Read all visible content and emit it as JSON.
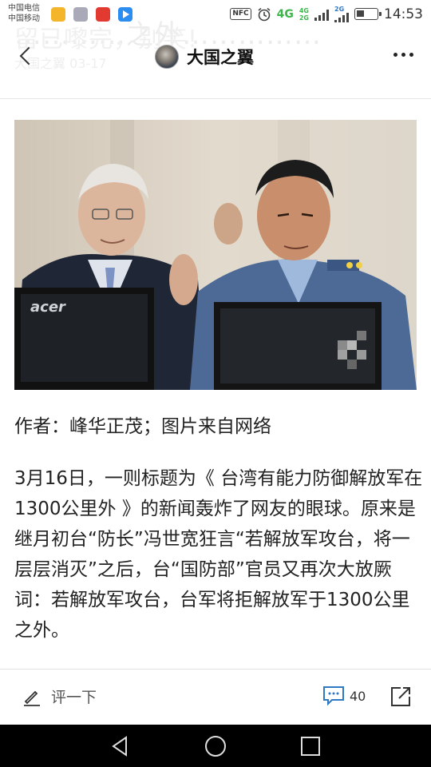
{
  "status_bar": {
    "carrier_1": "中国电信",
    "carrier_2": "中国移动",
    "nfc": "NFC",
    "network_4g": "4G",
    "network_small": "4G",
    "network_small_2": "2G",
    "network_2g_label": "2G",
    "time": "14:53"
  },
  "header": {
    "ghost_title": "…………之外……………",
    "ghost_title_line2": "留已嚟完，别笑!",
    "ghost_subtitle": "大国之翼  03-17",
    "title": "大国之翼",
    "back_icon": "chevron-left-icon",
    "more_icon": "more-dots-icon"
  },
  "article": {
    "author": "作者：峰华正茂；图片来自网络",
    "paragraph": "3月16日，一则标题为《 台湾有能力防御解放军在1300公里外 》的新闻轰炸了网友的眼球。原来是继月初台“防长”冯世宽狂言“若解放军攻台，将一层层消灭”之后，台“国防部”官员又再次大放厥词：若解放军攻台，台军将拒解放军于1300公里之外。",
    "photo_monitor_brand": "acer"
  },
  "action_bar": {
    "comment_placeholder": "评一下",
    "comment_count": "40"
  },
  "colors": {
    "accent_blue": "#2f78c4",
    "network_green": "#3bb54a",
    "text": "#222222"
  }
}
